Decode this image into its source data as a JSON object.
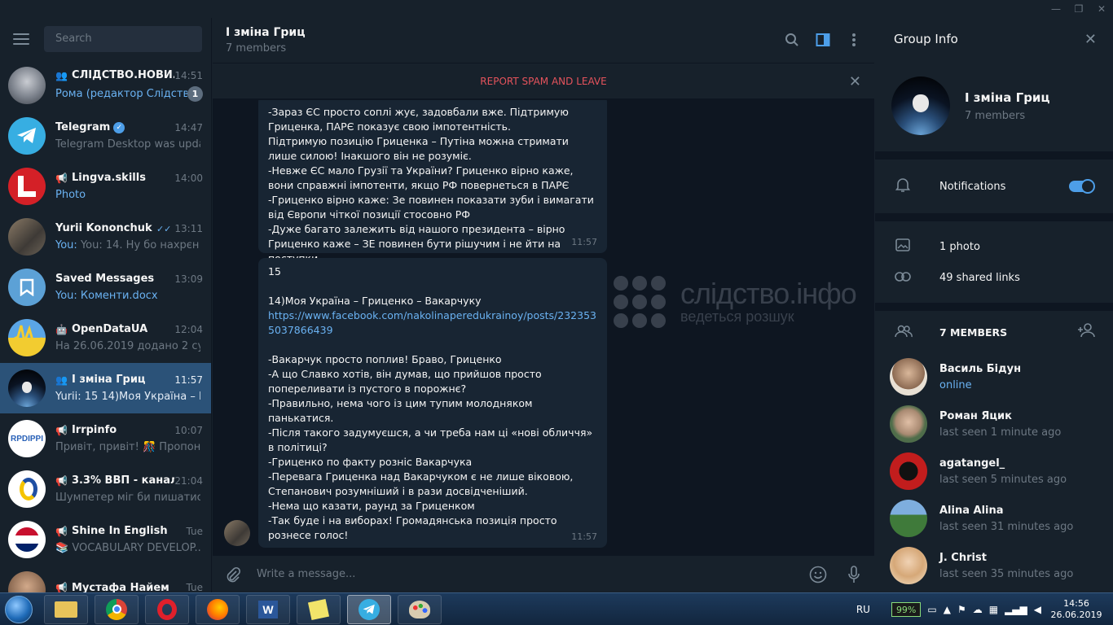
{
  "sidebar": {
    "search_placeholder": "Search",
    "chats": [
      {
        "name": "СЛІДСТВО.НОВИ...",
        "time": "14:51",
        "preview": "Рома (редактор Слідств...",
        "badge": "1",
        "type": "group"
      },
      {
        "name": "Telegram",
        "time": "14:47",
        "preview": "Telegram Desktop was updat...",
        "type": "verified"
      },
      {
        "name": "Lingva.skills",
        "time": "14:00",
        "preview": "Photo",
        "type": "channel"
      },
      {
        "name": "Yurii Kononchuk",
        "time": "13:11",
        "preview": "You: 14. Ну бо нахрєн йти в ...",
        "type": "user"
      },
      {
        "name": "Saved Messages",
        "time": "13:09",
        "preview": "You: Коменти.docx",
        "type": "saved"
      },
      {
        "name": "OpenDataUA",
        "time": "12:04",
        "preview": "На 26.06.2019 додано 2 судо...",
        "type": "bot"
      },
      {
        "name": "І зміна Гриц",
        "time": "11:57",
        "preview": "Yurii: 15  14)Моя Україна – Г...",
        "type": "group"
      },
      {
        "name": "Irrpinfo",
        "time": "10:07",
        "preview": "Привіт, привіт! 🎊 Пропон...",
        "type": "channel"
      },
      {
        "name": "3.3% ВВП - канал ...",
        "time": "21:04",
        "preview": "Шумпетер міг би пишатися...",
        "type": "channel"
      },
      {
        "name": "Shine In English",
        "time": "Tue",
        "preview": "📚 VOCABULARY DEVELOP...",
        "type": "channel"
      },
      {
        "name": "Мустафа Найем",
        "time": "Tue",
        "preview": "",
        "type": "channel"
      }
    ]
  },
  "chat": {
    "title": "І зміна Гриц",
    "subtitle": "7 members",
    "spam_label": "REPORT SPAM AND LEAVE",
    "messages": [
      {
        "text": "-Зараз ЄС просто соплі жує, задовбали вже. Підтримую Гриценка, ПАРЄ показує свою імпотентність.\nПідтримую позицію Гриценка – Путіна можна стримати лише силою! Інакшого він не розуміє.\n-Невже ЄС мало Грузії та України? Гриценко вірно каже, вони справжні імпотенти, якщо РФ повернеться в ПАРЄ\n-Гриценко вірно каже: Зе повинен показати зуби і вимагати від Європи чіткої позиції стосовно РФ\n-Дуже багато залежить від нашого президента – вірно Гриценко каже – ЗЕ повинен бути рішучим і не йти на поступки",
        "time": "11:57"
      },
      {
        "pre": "15\n\n14)Моя Україна – Гриценко – Вакарчуку\n",
        "link": "https://www.facebook.com/nakolinaperedukrainoy/posts/2323535037866439",
        "text": "-Вакарчук просто поплив! Браво, Гриценко\n-А що Славко хотів, він думав, що прийшов просто попереливати із пустого в порожнє?\n-Правильно, нема чого із цим тупим молодняком панькатися.\n-Після такого задумуєшся, а чи треба нам ці «нові обличчя» в політиці?\n-Гриценко по факту розніс Вакарчука\n-Перевага Гриценка над Вакарчуком є не лише віковою, Степанович розумніший і в рази досвідченіший.\n-Нема що казати, раунд за Гриценком\n-Так буде і на виборах! Громадянська позиція просто рознесе голос!",
        "time": "11:57"
      }
    ],
    "watermark_line1": "слідство.інфо",
    "watermark_line2": "ведеться розшук",
    "compose_placeholder": "Write a message..."
  },
  "info": {
    "title": "Group Info",
    "group_name": "І зміна Гриц",
    "group_sub": "7 members",
    "notifications_label": "Notifications",
    "notifications_on": true,
    "photos_label": "1 photo",
    "links_label": "49 shared links",
    "members_header": "7 MEMBERS",
    "members": [
      {
        "name": "Василь Бідун",
        "status": "online",
        "online": true
      },
      {
        "name": "Роман Яцик",
        "status": "last seen 1 minute ago"
      },
      {
        "name": "agatangel_",
        "status": "last seen 5 minutes ago"
      },
      {
        "name": "Alina Alina",
        "status": "last seen 31 minutes ago"
      },
      {
        "name": "J. Christ",
        "status": "last seen 35 minutes ago"
      }
    ]
  },
  "taskbar": {
    "lang": "RU",
    "battery": "99%",
    "time": "14:56",
    "date": "26.06.2019"
  }
}
